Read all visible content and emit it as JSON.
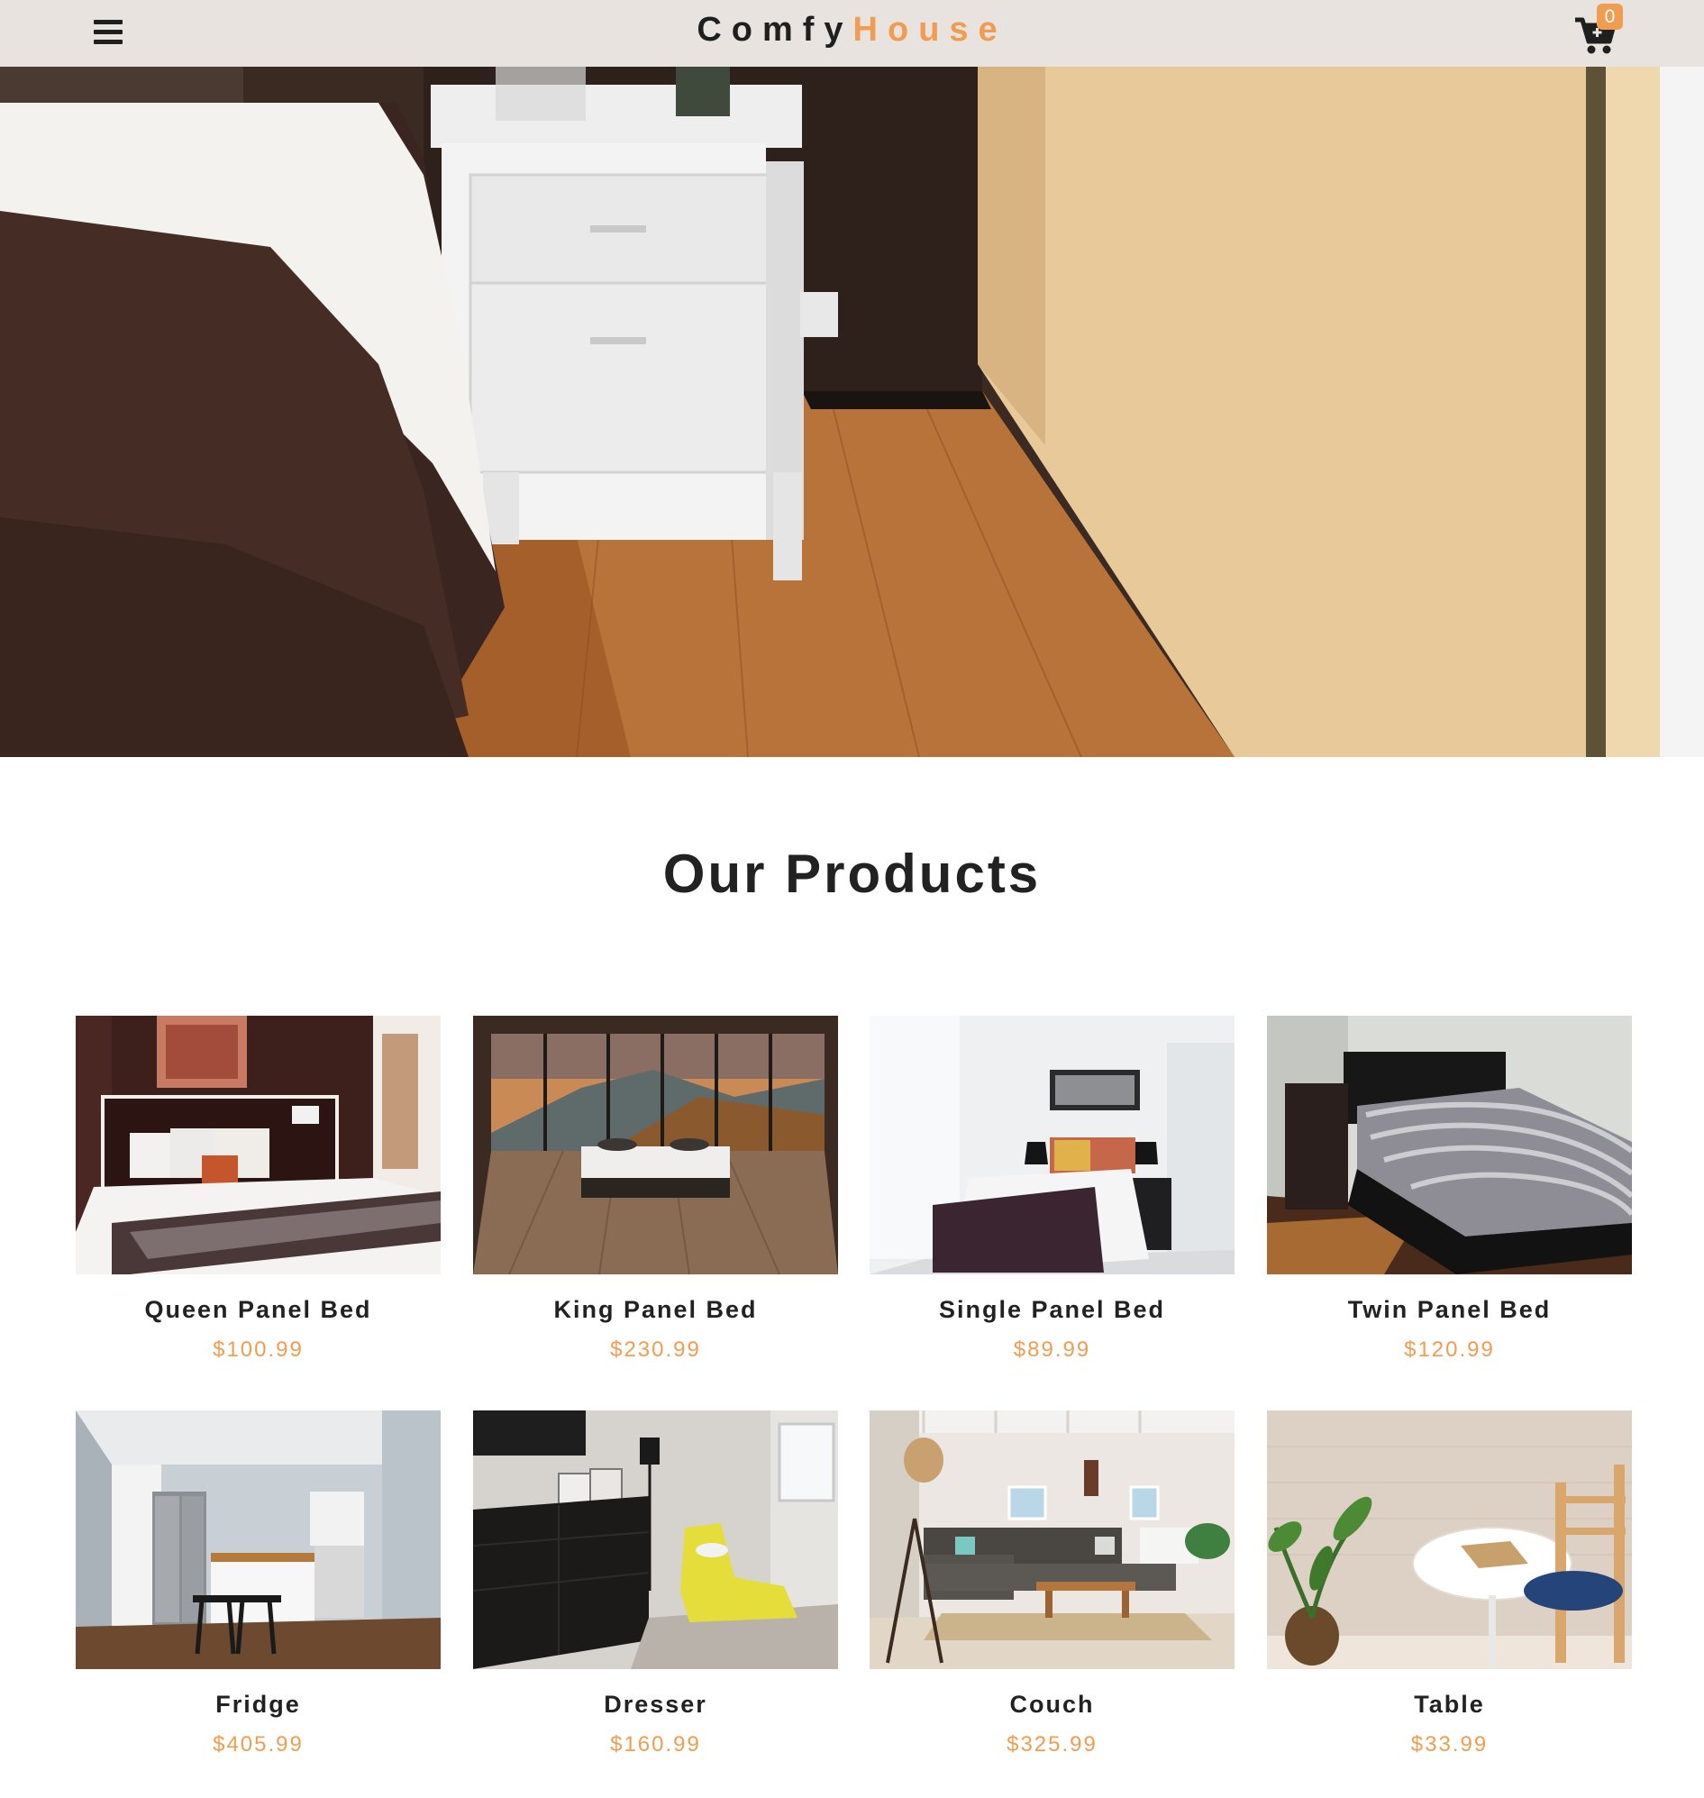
{
  "navbar": {
    "menu_icon": "hamburger-menu-icon",
    "logo_part1": "Comfy",
    "logo_part2": "House",
    "cart_icon": "shopping-cart-icon",
    "cart_count": "0"
  },
  "hero": {
    "image": "bedroom-hero-photo"
  },
  "products_section": {
    "title": "Our Products",
    "items": [
      {
        "name": "Queen Panel Bed",
        "price": "$100.99",
        "image": "queen-bed-photo"
      },
      {
        "name": "King Panel Bed",
        "price": "$230.99",
        "image": "king-bed-photo"
      },
      {
        "name": "Single Panel Bed",
        "price": "$89.99",
        "image": "single-bed-photo"
      },
      {
        "name": "Twin Panel Bed",
        "price": "$120.99",
        "image": "twin-bed-photo"
      },
      {
        "name": "Fridge",
        "price": "$405.99",
        "image": "kitchen-fridge-photo"
      },
      {
        "name": "Dresser",
        "price": "$160.99",
        "image": "dresser-photo"
      },
      {
        "name": "Couch",
        "price": "$325.99",
        "image": "couch-living-room-photo"
      },
      {
        "name": "Table",
        "price": "$33.99",
        "image": "table-chair-photo"
      }
    ]
  },
  "colors": {
    "accent": "#f09d51",
    "navbar_bg": "#e8e3df",
    "text": "#222222"
  }
}
